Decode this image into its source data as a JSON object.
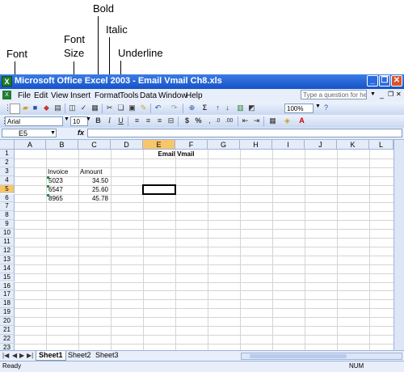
{
  "callouts": {
    "font": "Font",
    "font_size_line1": "Font",
    "font_size_line2": "Size",
    "bold": "Bold",
    "italic": "Italic",
    "underline": "Underline"
  },
  "window": {
    "title": "Microsoft Office Excel 2003 - Email Vmail Ch8.xls",
    "minimize": "_",
    "restore": "❐",
    "close": "✕"
  },
  "menu": {
    "items": [
      "File",
      "Edit",
      "View",
      "Insert",
      "Format",
      "Tools",
      "Data",
      "Window",
      "Help"
    ],
    "help_placeholder": "Type a question for help"
  },
  "format_toolbar": {
    "font": "Arial",
    "font_size": "10",
    "bold": "B",
    "italic": "I",
    "underline": "U",
    "currency": "$",
    "percent": "%"
  },
  "standard_toolbar": {
    "zoom": "100%",
    "sigma": "Σ"
  },
  "formula_bar": {
    "name_box": "E5",
    "fx": "fx",
    "value": ""
  },
  "grid": {
    "columns": [
      "A",
      "B",
      "C",
      "D",
      "E",
      "F",
      "G",
      "H",
      "I",
      "J",
      "K",
      "L"
    ],
    "rows": [
      "1",
      "2",
      "3",
      "4",
      "5",
      "6",
      "7",
      "8",
      "9",
      "10",
      "11",
      "12",
      "13",
      "14",
      "15",
      "16",
      "17",
      "18",
      "19",
      "20",
      "21",
      "22",
      "23"
    ],
    "active_column": "E",
    "active_row": "5",
    "title_cell": "Email Vmail",
    "header_invoice": "Invoice",
    "header_amount": "Amount",
    "data": [
      {
        "invoice": "5023",
        "amount": "34.50"
      },
      {
        "invoice": "6547",
        "amount": "25.60"
      },
      {
        "invoice": "8965",
        "amount": "45.78"
      }
    ]
  },
  "sheets": {
    "tabs": [
      "Sheet1",
      "Sheet2",
      "Sheet3"
    ],
    "active": "Sheet1"
  },
  "status": {
    "left": "Ready",
    "num": "NUM"
  }
}
